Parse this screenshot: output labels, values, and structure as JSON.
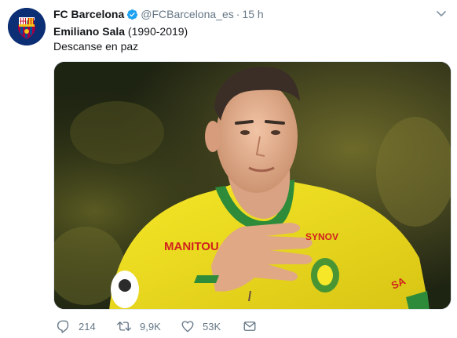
{
  "tweet": {
    "display_name": "FC Barcelona",
    "handle": "@FCBarcelona_es",
    "separator": "·",
    "time": "15 h",
    "line1_bold": "Emiliano Sala",
    "line1_rest": " (1990-2019)",
    "line2": "Descanse en paz",
    "photo": {
      "shirt_sponsor": "MANITOU",
      "shirt_sponsor_right": "SYNOV",
      "sleeve_text": "SA"
    }
  },
  "actions": {
    "replies": "214",
    "retweets": "9,9K",
    "likes": "53K"
  },
  "colors": {
    "text": "#14171a",
    "muted": "#657786",
    "verified": "#1da1f2",
    "shirt_yellow": "#f3e01c",
    "shirt_green": "#2e8b3a"
  }
}
